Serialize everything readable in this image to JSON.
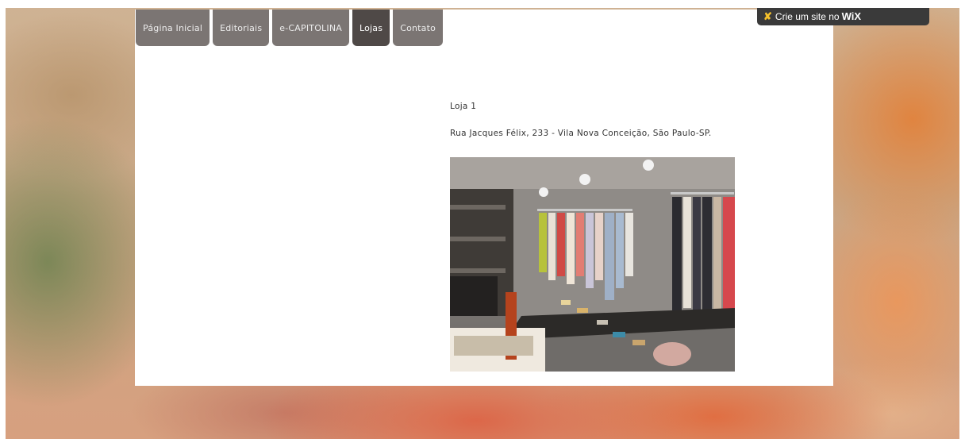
{
  "nav": {
    "tabs": [
      {
        "label": "Página Inicial",
        "active": false
      },
      {
        "label": "Editoriais",
        "active": false
      },
      {
        "label": "e-CAPITOLINA",
        "active": false
      },
      {
        "label": "Lojas",
        "active": true
      },
      {
        "label": "Contato",
        "active": false
      }
    ]
  },
  "wix_banner": {
    "text": "Crie um site no",
    "brand": "WiX",
    "icon": "wix-x-icon"
  },
  "content": {
    "store_title": "Loja 1",
    "store_address": "Rua Jacques Félix, 233 - Vila Nova Conceição, São Paulo-SP.",
    "photo_icon": "store-interior-photo"
  },
  "colors": {
    "tab_bg": "#7b7573",
    "tab_active_bg": "#4f4947",
    "banner_bg": "#3a3a3a",
    "banner_icon": "#f6c12b"
  }
}
